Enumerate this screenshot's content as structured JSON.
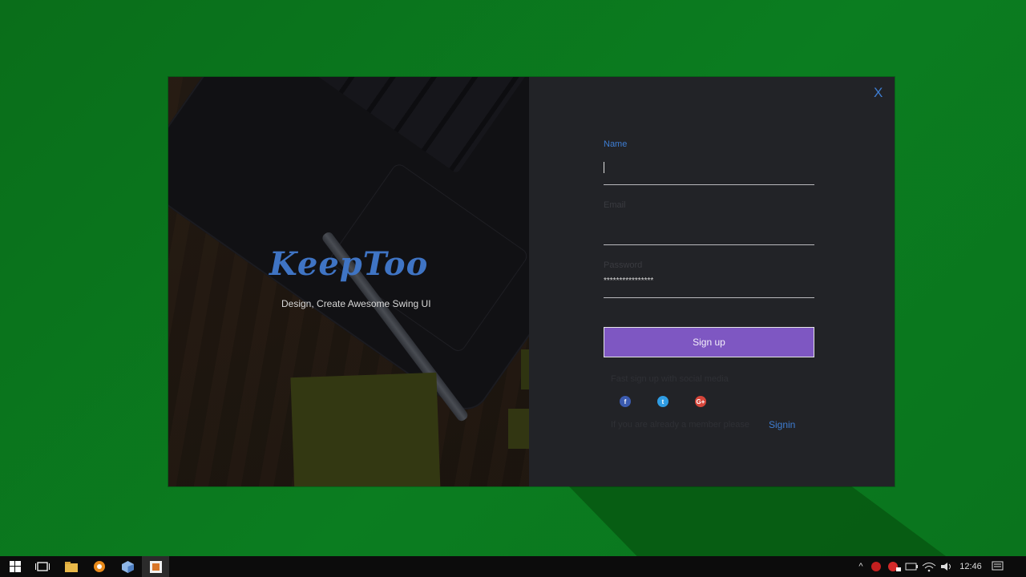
{
  "window": {
    "close_label": "X",
    "brand": "KeepToo",
    "tagline": "Design, Create Awesome Swing UI"
  },
  "form": {
    "name": {
      "label": "Name",
      "value": ""
    },
    "email": {
      "label": "Email",
      "value": ""
    },
    "password": {
      "label": "Password",
      "value": "****************"
    },
    "signup_label": "Sign up",
    "social_text": "Fast sign up with social media",
    "social": [
      {
        "name": "facebook-icon",
        "glyph": "f"
      },
      {
        "name": "twitter-icon",
        "glyph": "t"
      },
      {
        "name": "google-plus-icon",
        "glyph": "G+"
      }
    ],
    "member_text": "If you are already a member please",
    "signin_label": "Signin"
  },
  "colors": {
    "accent": "#3e7dd2",
    "button": "#7e57c2",
    "desktop": "#0b7a1e"
  },
  "taskbar": {
    "clock": "12:46",
    "icons": [
      "windows-start-icon",
      "task-view-icon",
      "file-explorer-icon",
      "compass-app-icon",
      "package-icon",
      "java-app-icon"
    ]
  }
}
